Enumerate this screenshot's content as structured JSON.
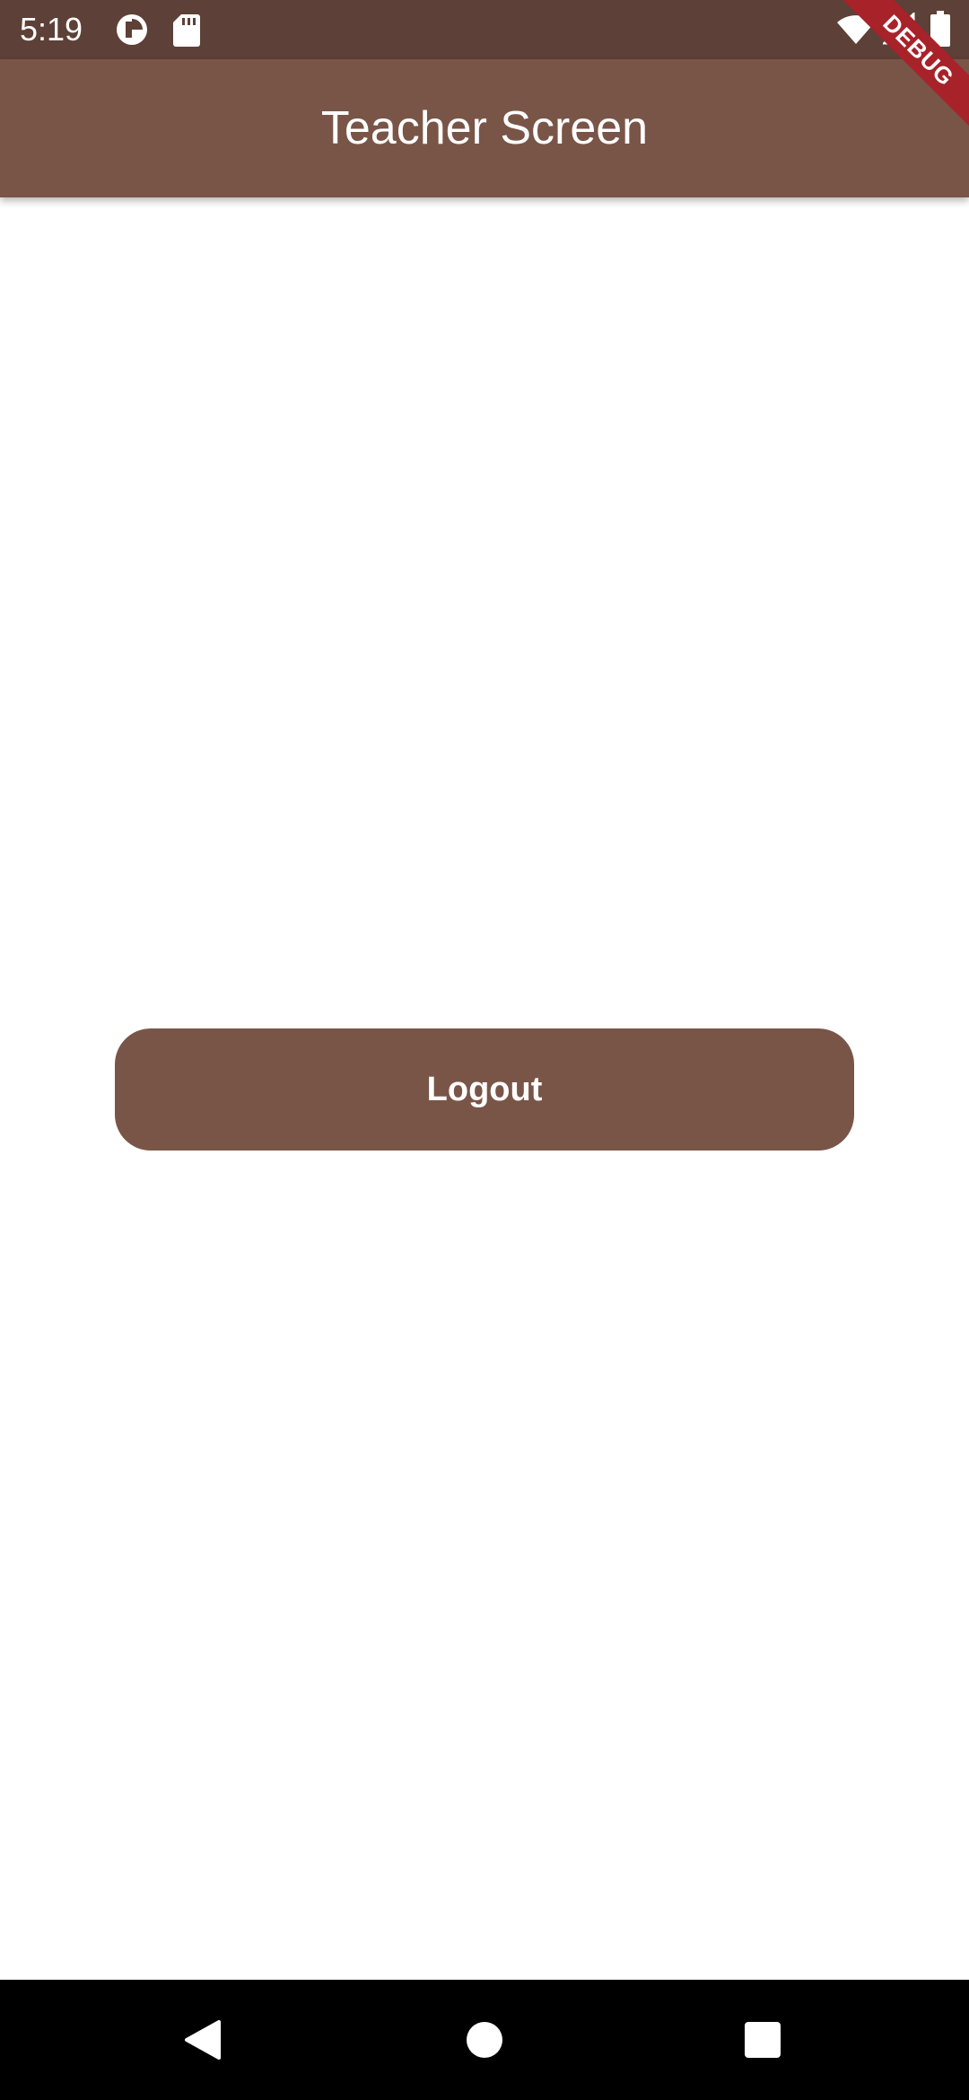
{
  "status_bar": {
    "time": "5:19",
    "left_icons": [
      "data-saver-icon",
      "sd-card-icon"
    ],
    "right_icons": [
      "wifi-icon",
      "cell-signal-icon",
      "battery-icon"
    ]
  },
  "debug_banner": {
    "label": "DEBUG",
    "color": "#a8222a"
  },
  "app_bar": {
    "title": "Teacher Screen",
    "color": "#795548"
  },
  "main": {
    "logout_label": "Logout"
  },
  "nav_bar": {
    "buttons": [
      "back-icon",
      "home-icon",
      "recents-icon"
    ]
  },
  "colors": {
    "status_bar": "#5d4037",
    "primary": "#795548",
    "background": "#ffffff",
    "nav_bar": "#000000"
  }
}
